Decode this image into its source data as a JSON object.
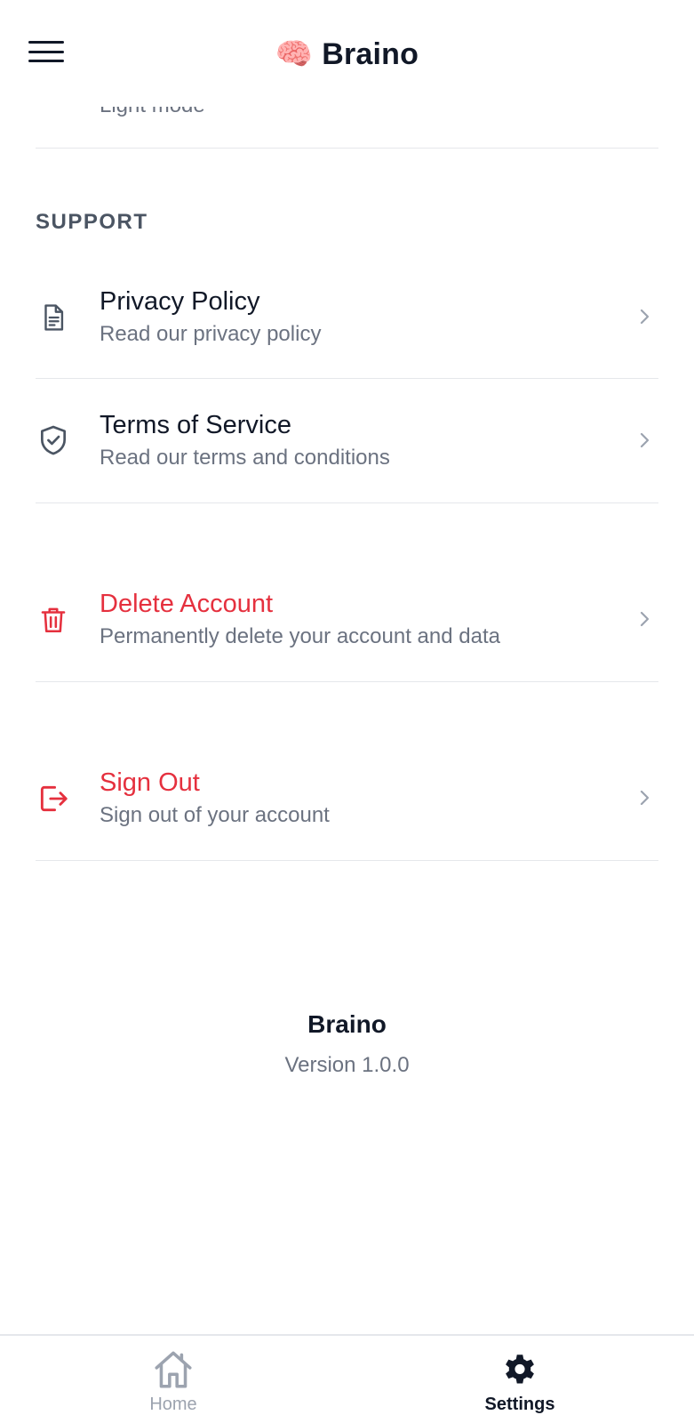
{
  "header": {
    "brand_emoji": "🧠",
    "brand_title": "Braino"
  },
  "appearance": {
    "subtitle": "Light mode"
  },
  "support": {
    "section_label": "SUPPORT",
    "privacy_title": "Privacy Policy",
    "privacy_subtitle": "Read our privacy policy",
    "terms_title": "Terms of Service",
    "terms_subtitle": "Read our terms and conditions"
  },
  "account": {
    "delete_title": "Delete Account",
    "delete_subtitle": "Permanently delete your account and data",
    "signout_title": "Sign Out",
    "signout_subtitle": "Sign out of your account"
  },
  "footer": {
    "app_name": "Braino",
    "version": "Version 1.0.0"
  },
  "bottom_nav": {
    "home_label": "Home",
    "settings_label": "Settings"
  },
  "colors": {
    "danger": "#e5303e",
    "text_primary": "#111827",
    "text_secondary": "#6b7280",
    "divider": "#e5e7eb"
  }
}
